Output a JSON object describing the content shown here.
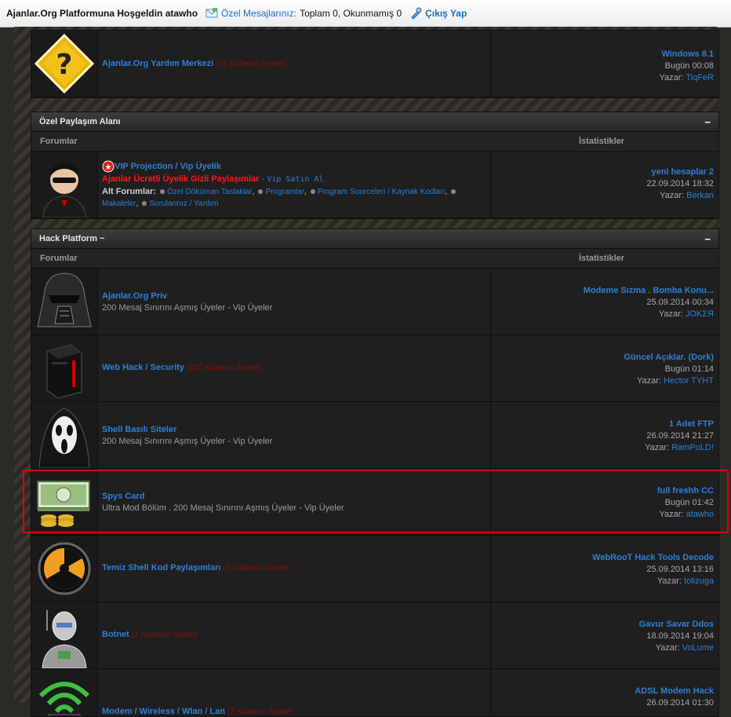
{
  "topbar": {
    "welcome": "Ajanlar.Org Platformuna Hoşgeldin atawho",
    "pm_label": "Özel Mesajlarınız:",
    "pm_counts": "Toplam 0, Okunmamış 0",
    "logout": "Çıkış Yap"
  },
  "help_row": {
    "title": "Ajanlar.Org Yardım Merkezi",
    "inside": "(31 Kullanıcı İçerde)",
    "last_title": "Windows 8.1",
    "last_date": "Bugün 00:08",
    "author_label": "Yazar:",
    "author": "TiqFeR"
  },
  "section1": {
    "title": "Özel Paylaşım Alanı",
    "collapse": "−",
    "col_forums": "Forumlar",
    "col_stats": "İstatistikler",
    "forum": {
      "title": "VIP Projection / Vip Üyelik",
      "red_text": "Ajanlar Ücretli Üyelik Gizli Paylaşımlar",
      "sep": " - ",
      "buy_text": "Vip Satın Al",
      "sub_label": "Alt Forumlar:",
      "subforums": [
        "Özel Döküman Taslaklar",
        "Programlar",
        "Program Sourceleri / Kaynak Kodları",
        "Makaleler",
        "Sorularınız / Yardım"
      ],
      "last_title": "yeni hesaplar 2",
      "last_date": "22.09.2014 18:32",
      "author_label": "Yazar:",
      "author": "Berkan"
    }
  },
  "section2": {
    "title": "Hack Platform ~",
    "collapse": "−",
    "col_forums": "Forumlar",
    "col_stats": "İstatistikler",
    "forums": [
      {
        "title": "Ajanlar.Org Priv",
        "inside": "",
        "desc": "200 Mesaj Sınırını Aşmış Üyeler - Vip Üyeler",
        "last_title": "Modeme Sızma . Bomba Konu...",
        "last_date": "25.09.2014 00:34",
        "author_label": "Yazar:",
        "author": "JOKΣЯ"
      },
      {
        "title": "Web Hack / Security",
        "inside": "(100 Kullanıcı İçerde)",
        "desc": "",
        "last_title": "Güncel Açıklar. (Dork)",
        "last_date": "Bugün 01:14",
        "author_label": "Yazar:",
        "author": "Hector TYHT"
      },
      {
        "title": "Shell Basılı Siteler",
        "inside": "",
        "desc": "200 Mesaj Sınırını Aşmış Üyeler - Vip Üyeler",
        "last_title": "1 Adet FTP",
        "last_date": "26.09.2014 21:27",
        "author_label": "Yazar:",
        "author": "RamPoLD!"
      },
      {
        "title": "Spys Card",
        "inside": "",
        "desc": "Ultra Mod Bölüm . 200 Mesaj Sınırını Aşmış Üyeler - Vip Üyeler",
        "last_title": "full freshh CC",
        "last_date": "Bugün 01:42",
        "author_label": "Yazar:",
        "author": "atawho"
      },
      {
        "title": "Temiz Shell Kod Paylaşımları",
        "inside": "(3 Kullanıcı İçerde)",
        "desc": "",
        "last_title": "WebRooT Hack Tools Decode",
        "last_date": "25.09.2014 13:16",
        "author_label": "Yazar:",
        "author": "tolizuga"
      },
      {
        "title": "Botnet",
        "inside": "(1 Kullanıcı İçerde)",
        "desc": "",
        "last_title": "Gavur Savar Ddos",
        "last_date": "18.09.2014 19:04",
        "author_label": "Yazar:",
        "author": "VoLume"
      },
      {
        "title": "Modem / Wireless / Wlan / Lan",
        "inside": "(2 Kullanıcı İçerde)",
        "desc": "",
        "last_title": "ADSL Modem Hack",
        "last_date": "26.09.2014 01:30",
        "author_label": "Yazar:",
        "author": ""
      }
    ]
  },
  "colors": {
    "link": "#2d7fd6",
    "inside": "#8b1010",
    "highlight": "#e00000",
    "vip_red": "#ff1a1a"
  }
}
